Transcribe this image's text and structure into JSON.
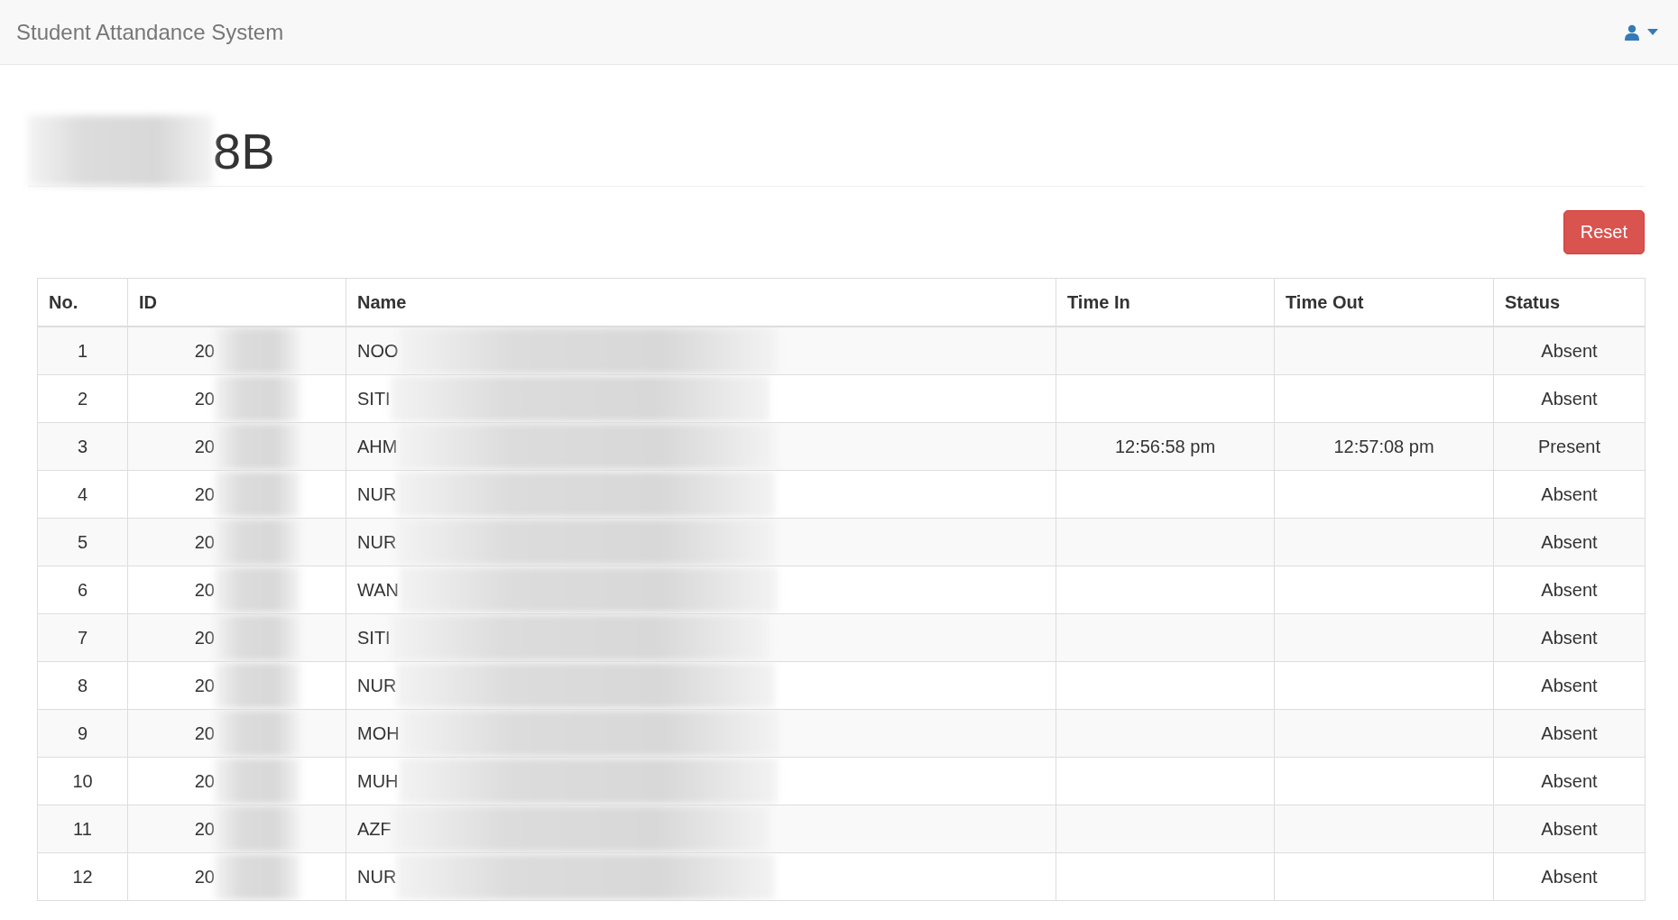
{
  "navbar": {
    "brand": "Student Attandance System"
  },
  "page_title": "8B",
  "reset_button": "Reset",
  "table": {
    "columns": [
      "No.",
      "ID",
      "Name",
      "Time In",
      "Time Out",
      "Status"
    ],
    "rows": [
      {
        "no": "1",
        "id": "20",
        "name": "NOO",
        "status": "Absent"
      },
      {
        "no": "2",
        "id": "20",
        "name": "SITI",
        "status": "Absent"
      },
      {
        "no": "3",
        "id": "20",
        "name": "AHM",
        "time_in": "12:56:58 pm",
        "time_out": "12:57:08 pm",
        "status": "Present"
      },
      {
        "no": "4",
        "id": "20",
        "name": "NUR",
        "status": "Absent"
      },
      {
        "no": "5",
        "id": "20",
        "name": "NUR",
        "status": "Absent"
      },
      {
        "no": "6",
        "id": "20",
        "name": "WAN",
        "status": "Absent"
      },
      {
        "no": "7",
        "id": "20",
        "name": "SITI",
        "status": "Absent"
      },
      {
        "no": "8",
        "id": "20",
        "name": "NUR",
        "status": "Absent"
      },
      {
        "no": "9",
        "id": "20",
        "name": "MOH",
        "status": "Absent"
      },
      {
        "no": "10",
        "id": "20",
        "name": "MUH",
        "status": "Absent"
      },
      {
        "no": "11",
        "id": "20",
        "name": "AZF",
        "status": "Absent"
      },
      {
        "no": "12",
        "id": "20",
        "name": "NUR",
        "status": "Absent"
      }
    ]
  }
}
